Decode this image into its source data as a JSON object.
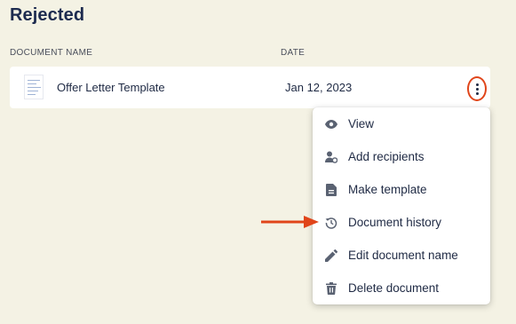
{
  "section": {
    "title": "Rejected"
  },
  "table": {
    "headers": {
      "document_name": "DOCUMENT NAME",
      "date": "DATE"
    },
    "rows": [
      {
        "name": "Offer Letter Template",
        "date": "Jan 12, 2023"
      }
    ]
  },
  "menu": {
    "items": [
      {
        "label": "View",
        "icon": "eye-icon"
      },
      {
        "label": "Add recipients",
        "icon": "add-user-icon"
      },
      {
        "label": "Make template",
        "icon": "document-icon"
      },
      {
        "label": "Document history",
        "icon": "history-icon"
      },
      {
        "label": "Edit document name",
        "icon": "pencil-icon"
      },
      {
        "label": "Delete document",
        "icon": "trash-icon"
      }
    ]
  },
  "colors": {
    "background": "#f4f2e4",
    "title": "#1d2b4f",
    "highlight": "#e0451a",
    "icon": "#5a6272"
  }
}
